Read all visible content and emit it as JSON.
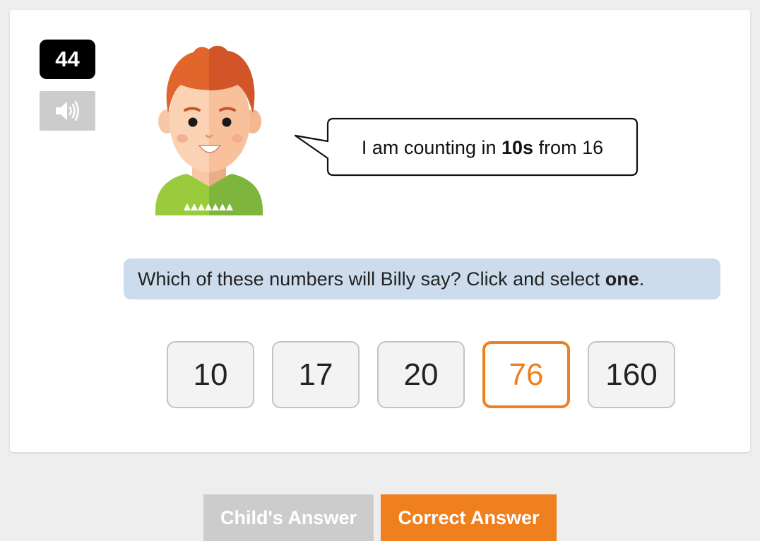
{
  "question": {
    "number": "44",
    "audio_icon": "speaker-icon",
    "speech": {
      "prefix": "I am counting in ",
      "bold": "10s",
      "suffix": " from 16"
    },
    "instruction": {
      "prefix": "Which of these numbers will Billy say? Click and select ",
      "bold": "one",
      "suffix": "."
    },
    "options": [
      "10",
      "17",
      "20",
      "76",
      "160"
    ],
    "selected_option": "76"
  },
  "answer_tabs": {
    "child_label": "Child's Answer",
    "correct_label": "Correct Answer",
    "active": "Correct Answer"
  },
  "colors": {
    "accent": "#f07f1d",
    "instruction_bg": "#cddced",
    "inactive_tab": "#cccccc",
    "question_number_bg": "#000000"
  }
}
